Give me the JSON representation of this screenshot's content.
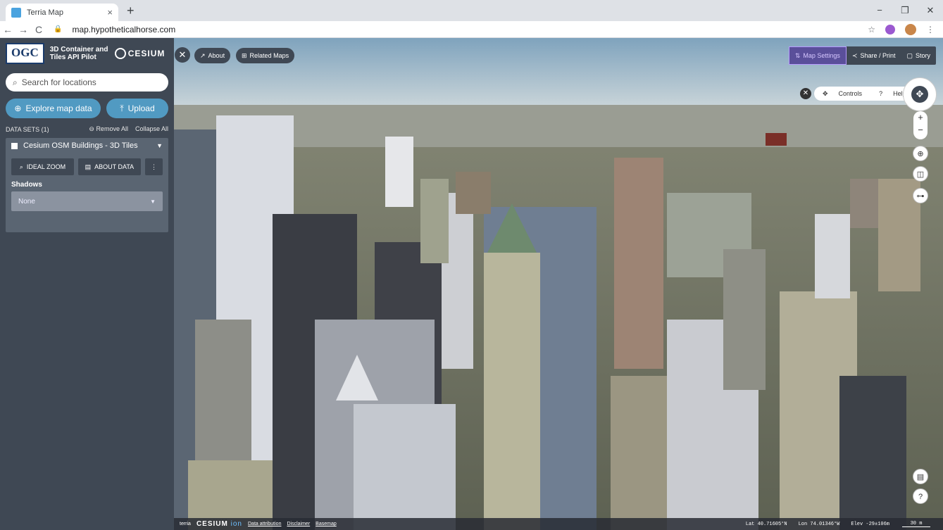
{
  "browser": {
    "tab_title": "Terria Map",
    "tab_close": "×",
    "new_tab": "+",
    "min": "−",
    "restore": "❐",
    "close": "✕",
    "back": "←",
    "fwd": "→",
    "reload": "C",
    "url": "map.hypotheticalhorse.com",
    "star": "☆",
    "menu": "⋮"
  },
  "panel": {
    "ogc": "OGC",
    "pilot": "3D Container and Tiles API Pilot",
    "cesium": "CESIUM",
    "search_placeholder": "Search for locations",
    "explore": "Explore map data",
    "upload": "Upload",
    "datasets": "DATA SETS  (1)",
    "remove_all": "Remove All",
    "collapse_all": "Collapse All",
    "item": "Cesium OSM Buildings - 3D Tiles",
    "ideal_zoom": "IDEAL ZOOM",
    "about_data": "ABOUT DATA",
    "shadows_label": "Shadows",
    "shadows_value": "None"
  },
  "top": {
    "about": "About",
    "related": "Related Maps",
    "map_settings": "Map Settings",
    "share": "Share / Print",
    "story": "Story"
  },
  "controls": {
    "controls": "Controls",
    "help": "Help",
    "zoom_in": "+",
    "zoom_out": "−"
  },
  "footer": {
    "ion": "CESIUM",
    "ion2": "ion",
    "attr": "Data attribution",
    "disclaimer": "Disclaimer",
    "basemap": "Basemap",
    "terria": "terria",
    "lat": "Lat  40.71605°N",
    "lon": "Lon  74.01346°W",
    "elev": "Elev  -29±106m",
    "scale": "30 m"
  },
  "colors": {
    "panel": "#3f4854",
    "accent": "#519ac2",
    "settings": "#5a4f9a"
  }
}
